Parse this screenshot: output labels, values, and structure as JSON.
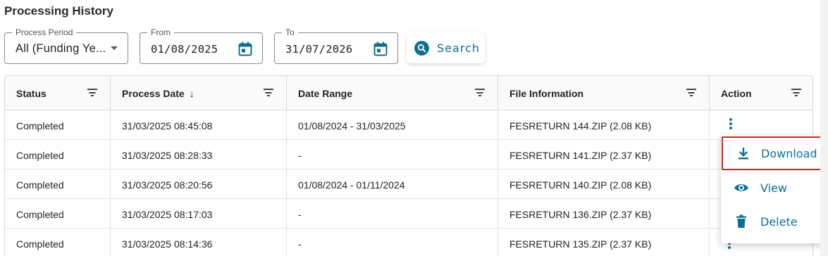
{
  "page": {
    "title": "Processing History"
  },
  "filters": {
    "process_period": {
      "label": "Process Period",
      "value": "All (Funding Ye..."
    },
    "from": {
      "label": "From",
      "value": "01/08/2025"
    },
    "to": {
      "label": "To",
      "value": "31/07/2026"
    },
    "search_label": "Search"
  },
  "table": {
    "columns": [
      {
        "label": "Status"
      },
      {
        "label": "Process Date",
        "sort": "↓"
      },
      {
        "label": "Date Range"
      },
      {
        "label": "File Information"
      },
      {
        "label": "Action"
      }
    ],
    "rows": [
      {
        "status": "Completed",
        "process_date": "31/03/2025 08:45:08",
        "date_range": "01/08/2024 - 31/03/2025",
        "file_info": "FESRETURN 144.ZIP (2.08 KB)"
      },
      {
        "status": "Completed",
        "process_date": "31/03/2025 08:28:33",
        "date_range": "-",
        "file_info": "FESRETURN 141.ZIP (2.37 KB)"
      },
      {
        "status": "Completed",
        "process_date": "31/03/2025 08:20:56",
        "date_range": "01/08/2024 - 01/11/2024",
        "file_info": "FESRETURN 140.ZIP (2.08 KB)"
      },
      {
        "status": "Completed",
        "process_date": "31/03/2025 08:17:03",
        "date_range": "-",
        "file_info": "FESRETURN 136.ZIP (2.37 KB)"
      },
      {
        "status": "Completed",
        "process_date": "31/03/2025 08:14:36",
        "date_range": "-",
        "file_info": "FESRETURN 135.ZIP (2.37 KB)"
      }
    ]
  },
  "action_menu": {
    "items": [
      {
        "label": "Download",
        "icon": "download-icon"
      },
      {
        "label": "View",
        "icon": "eye-icon"
      },
      {
        "label": "Delete",
        "icon": "trash-icon"
      }
    ]
  },
  "colors": {
    "accent": "#0d6f91",
    "highlight_border": "#d2202a"
  }
}
